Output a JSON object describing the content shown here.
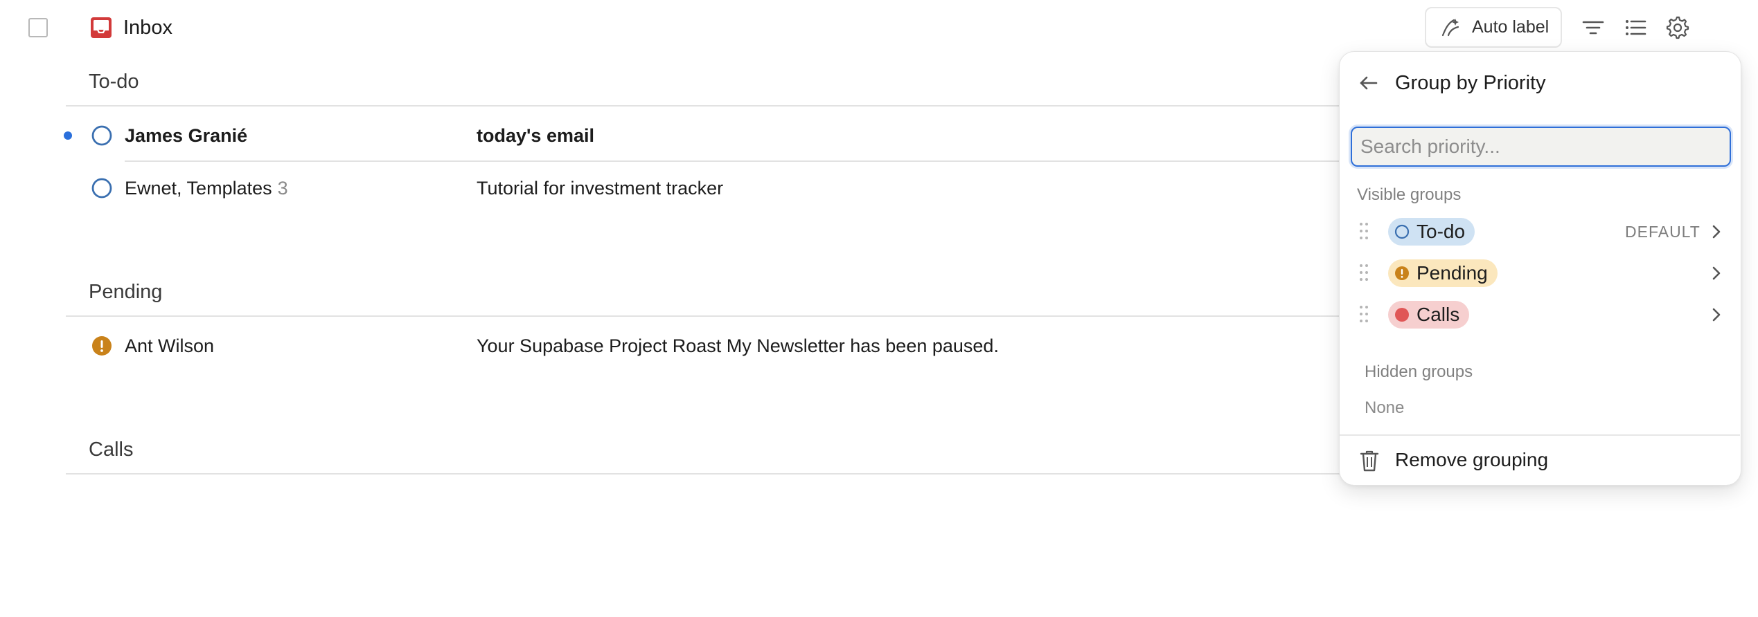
{
  "header": {
    "title": "Inbox",
    "auto_label": "Auto label"
  },
  "sections": [
    {
      "title": "To-do",
      "rows": [
        {
          "sender": "James Granié",
          "subject": "today's email",
          "unread": true
        },
        {
          "sender": "Ewnet, Templates",
          "count": "3",
          "subject": "Tutorial for investment tracker",
          "unread": false
        }
      ]
    },
    {
      "title": "Pending",
      "rows": [
        {
          "sender": "Ant Wilson",
          "subject": "Your Supabase Project Roast My Newsletter has been paused.",
          "unread": false
        }
      ]
    },
    {
      "title": "Calls",
      "rows": []
    }
  ],
  "popover": {
    "title": "Group by Priority",
    "search_placeholder": "Search priority...",
    "visible_label": "Visible groups",
    "groups": [
      {
        "name": "To-do",
        "tag": "DEFAULT",
        "chip_color": "#cfe2f3",
        "icon_color": "#3a6fb0"
      },
      {
        "name": "Pending",
        "tag": "",
        "chip_color": "#fbe7bd",
        "icon_color": "#c9821a"
      },
      {
        "name": "Calls",
        "tag": "",
        "chip_color": "#f6cfcf",
        "icon_color": "#e05757"
      }
    ],
    "hidden_label": "Hidden groups",
    "hidden_none": "None",
    "remove_label": "Remove grouping"
  },
  "colors": {
    "accent": "#2f6fd8",
    "inbox_icon": "#d23a3a",
    "unread_dot": "#2a6fdb",
    "pending_icon": "#c9821a"
  },
  "icons": [
    "inbox-icon",
    "auto-label-icon",
    "filter-icon",
    "list-icon",
    "gear-icon",
    "back-arrow-icon",
    "drag-handle-icon",
    "chevron-right-icon",
    "trash-icon"
  ]
}
